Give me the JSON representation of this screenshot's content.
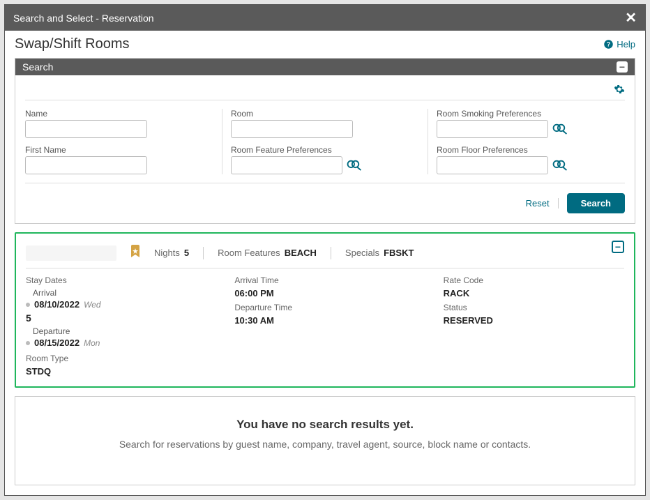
{
  "modal": {
    "title": "Search and Select - Reservation"
  },
  "page": {
    "title": "Swap/Shift Rooms",
    "help_label": "Help"
  },
  "search_panel": {
    "header": "Search",
    "fields": {
      "name_label": "Name",
      "first_name_label": "First Name",
      "room_label": "Room",
      "room_feature_pref_label": "Room Feature Preferences",
      "room_smoking_pref_label": "Room Smoking Preferences",
      "room_floor_pref_label": "Room Floor Preferences"
    },
    "actions": {
      "reset": "Reset",
      "search": "Search"
    }
  },
  "result": {
    "summary": {
      "nights_label": "Nights",
      "nights_value": "5",
      "room_features_label": "Room Features",
      "room_features_value": "BEACH",
      "specials_label": "Specials",
      "specials_value": "FBSKT"
    },
    "details": {
      "stay_dates_label": "Stay Dates",
      "arrival_label": "Arrival",
      "arrival_date": "08/10/2022",
      "arrival_dow": "Wed",
      "nights_count": "5",
      "departure_label": "Departure",
      "departure_date": "08/15/2022",
      "departure_dow": "Mon",
      "room_type_label": "Room Type",
      "room_type_value": "STDQ",
      "arrival_time_label": "Arrival Time",
      "arrival_time_value": "06:00 PM",
      "departure_time_label": "Departure Time",
      "departure_time_value": "10:30 AM",
      "rate_code_label": "Rate Code",
      "rate_code_value": "RACK",
      "status_label": "Status",
      "status_value": "RESERVED"
    }
  },
  "empty_state": {
    "title": "You have no search results yet.",
    "subtitle": "Search for reservations by guest name, company, travel agent, source, block name or contacts."
  }
}
